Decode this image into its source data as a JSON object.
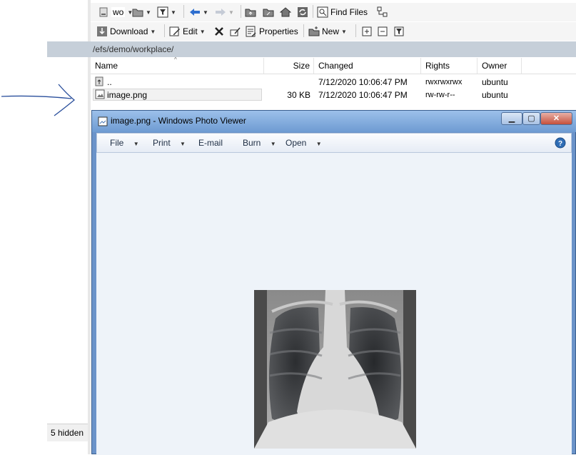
{
  "toolbar1": {
    "drive_label": "wo",
    "find_files_label": "Find Files"
  },
  "toolbar2": {
    "download_label": "Download",
    "edit_label": "Edit",
    "properties_label": "Properties",
    "new_label": "New"
  },
  "path": "/efs/demo/workplace/",
  "columns": {
    "name": "Name",
    "size": "Size",
    "changed": "Changed",
    "rights": "Rights",
    "owner": "Owner"
  },
  "files": [
    {
      "name": "..",
      "size": "",
      "changed": "7/12/2020 10:06:47 PM",
      "rights": "rwxrwxrwx",
      "owner": "ubuntu"
    },
    {
      "name": "image.png",
      "size": "30 KB",
      "changed": "7/12/2020 10:06:47 PM",
      "rights": "rw-rw-r--",
      "owner": "ubuntu"
    }
  ],
  "left_status": "5 hidden",
  "viewer": {
    "title": "image.png - Windows Photo Viewer",
    "menu": {
      "file": "File",
      "print": "Print",
      "email": "E-mail",
      "burn": "Burn",
      "open": "Open"
    }
  },
  "icons": {
    "back": "arrow-left-icon",
    "forward": "arrow-right-icon",
    "home": "home-icon",
    "refresh": "refresh-icon",
    "help": "help-icon"
  },
  "colors": {
    "pathbar": "#c6cfd9",
    "viewer_title": "#6e9bd2",
    "arrow": "#2a4f9c"
  }
}
